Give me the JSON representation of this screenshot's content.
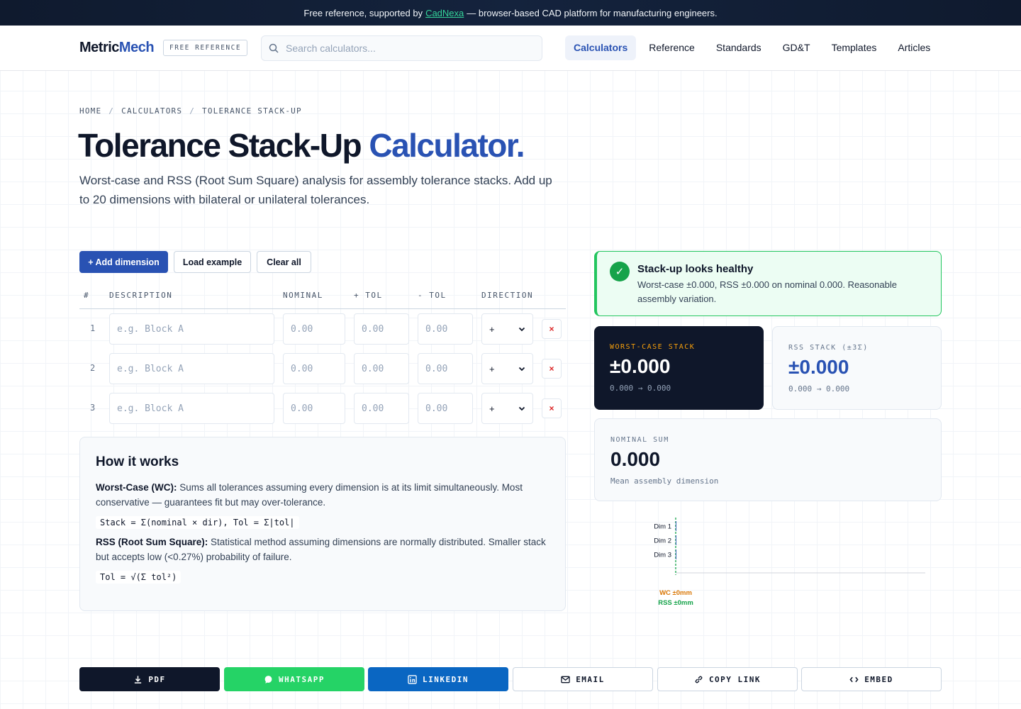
{
  "banner": {
    "prefix": "Free reference, supported by",
    "link": "CadNexa",
    "suffix": "— browser-based CAD platform for manufacturing engineers."
  },
  "header": {
    "logo_part1": "Metric",
    "logo_part2": "Mech",
    "badge": "FREE REFERENCE",
    "search_placeholder": "Search calculators...",
    "nav": [
      "Calculators",
      "Reference",
      "Standards",
      "GD&T",
      "Templates",
      "Articles"
    ],
    "active_nav": "Calculators"
  },
  "breadcrumb": [
    "HOME",
    "CALCULATORS",
    "TOLERANCE STACK-UP"
  ],
  "hero": {
    "title_main": "Tolerance Stack-Up",
    "title_highlight": "Calculator.",
    "lede": "Worst-case and RSS (Root Sum Square) analysis for assembly tolerance stacks. Add up to 20 dimensions with bilateral or unilateral tolerances."
  },
  "toolbar": {
    "add": "+ Add dimension",
    "load": "Load example",
    "clear": "Clear all"
  },
  "table": {
    "headers": [
      "#",
      "DESCRIPTION",
      "NOMINAL",
      "+ TOL",
      "- TOL",
      "DIRECTION"
    ],
    "rows": [
      {
        "num": "1",
        "desc_placeholder": "e.g. Block A",
        "nominal_placeholder": "0.00",
        "plus_placeholder": "0.00",
        "minus_placeholder": "0.00",
        "direction": "+"
      },
      {
        "num": "2",
        "desc_placeholder": "e.g. Block A",
        "nominal_placeholder": "0.00",
        "plus_placeholder": "0.00",
        "minus_placeholder": "0.00",
        "direction": "+"
      },
      {
        "num": "3",
        "desc_placeholder": "e.g. Block A",
        "nominal_placeholder": "0.00",
        "plus_placeholder": "0.00",
        "minus_placeholder": "0.00",
        "direction": "+"
      }
    ],
    "delete_glyph": "×"
  },
  "how": {
    "title": "How it works",
    "wc_label": "Worst-Case (WC):",
    "wc_text": "Sums all tolerances assuming every dimension is at its limit simultaneously. Most conservative — guarantees fit but may over-tolerance.",
    "wc_formula": "Stack = Σ(nominal × dir), Tol = Σ|tol|",
    "rss_label": "RSS (Root Sum Square):",
    "rss_text": "Statistical method assuming dimensions are normally distributed. Smaller stack but accepts low (<0.27%) probability of failure.",
    "rss_formula": "Tol = √(Σ tol²)"
  },
  "status": {
    "icon": "✓",
    "title": "Stack-up looks healthy",
    "body": "Worst-case ±0.000, RSS ±0.000 on nominal 0.000. Reasonable assembly variation."
  },
  "metrics": {
    "worst_case": {
      "label": "WORST-CASE STACK",
      "value": "±0.000",
      "range": "0.000 → 0.000"
    },
    "rss": {
      "label": "RSS STACK (±3Σ)",
      "value": "±0.000",
      "range": "0.000 → 0.000"
    },
    "nominal": {
      "label": "NOMINAL SUM",
      "value": "0.000",
      "sub": "Mean assembly dimension"
    }
  },
  "chart_data": {
    "type": "bar",
    "categories": [
      "Dim 1",
      "Dim 2",
      "Dim 3"
    ],
    "values": [
      0,
      0,
      0
    ],
    "annotations": [
      {
        "text": "WC ±0mm",
        "color": "#d97706"
      },
      {
        "text": "RSS ±0mm",
        "color": "#16a34a"
      }
    ],
    "grid": false
  },
  "share": [
    "PDF",
    "WHATSAPP",
    "LINKEDIN",
    "EMAIL",
    "COPY LINK",
    "EMBED"
  ],
  "colors": {
    "accent": "#2952b3",
    "dark": "#0f172a",
    "success": "#16a34a",
    "warning": "#d97706",
    "whatsapp": "#25d366",
    "linkedin": "#0a66c2"
  }
}
